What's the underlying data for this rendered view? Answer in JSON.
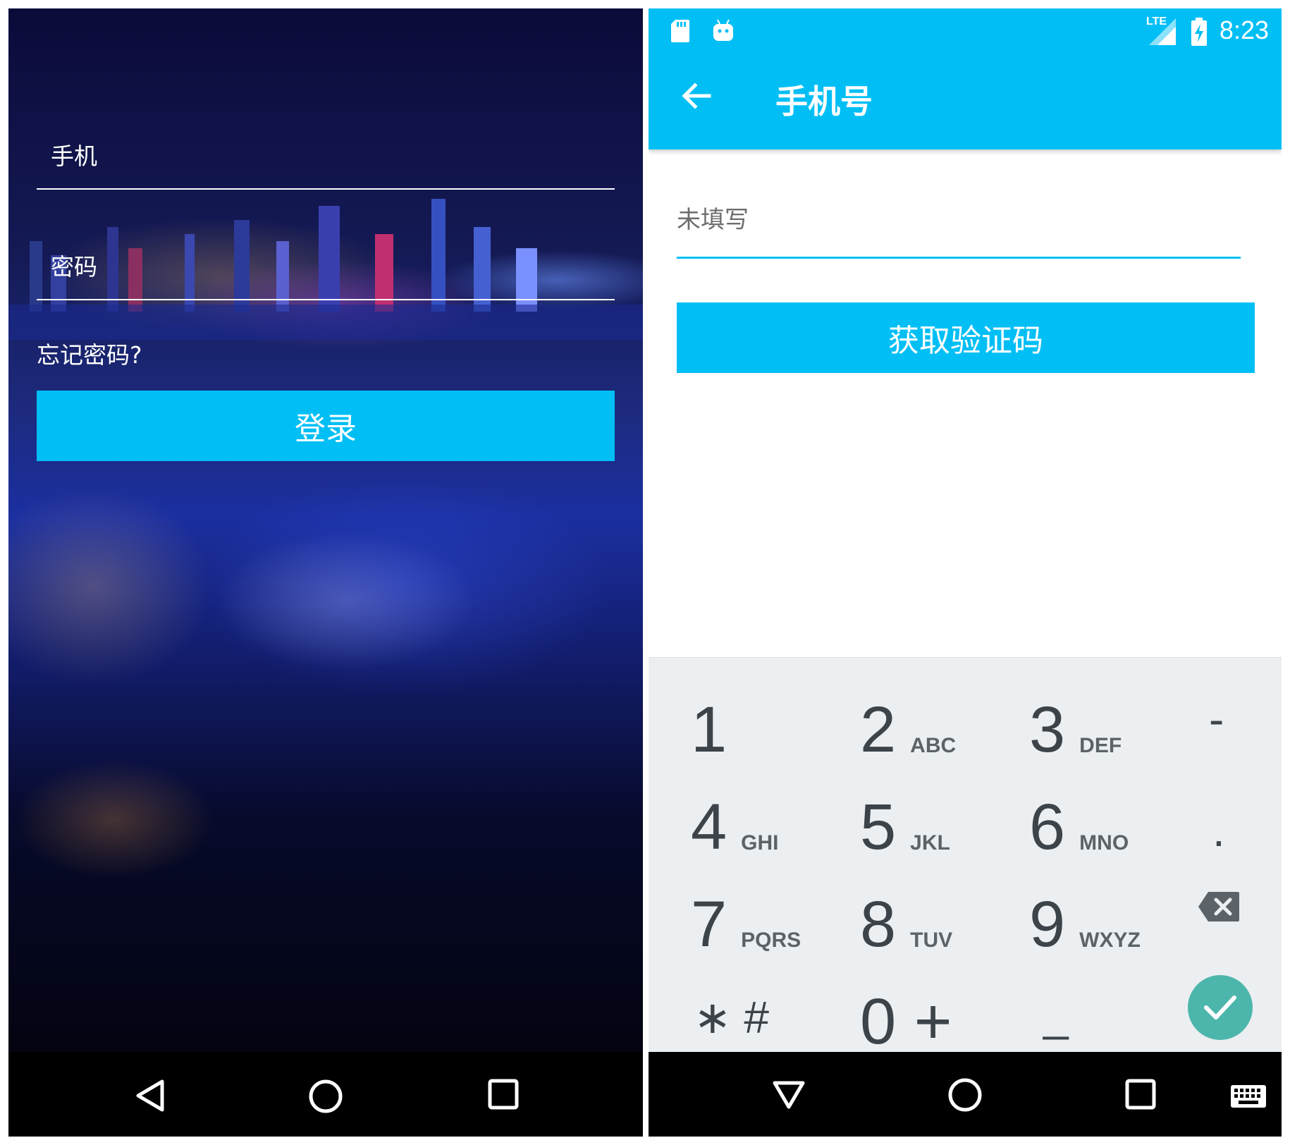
{
  "login_screen": {
    "phone_hint": "手机",
    "password_hint": "密码",
    "forgot_password": "忘记密码?",
    "login_button": "登录",
    "nav": [
      "back-icon",
      "home-icon",
      "recents-icon"
    ]
  },
  "phone_screen": {
    "status_bar": {
      "time": "8:23",
      "network": "LTE",
      "icons": [
        "sd-card-icon",
        "android-icon",
        "signal-icon",
        "battery-charging-icon"
      ]
    },
    "app_bar": {
      "title": "手机号",
      "back_icon": "arrow-left-icon"
    },
    "phone_field": {
      "placeholder": "未填写",
      "value": ""
    },
    "get_code_button": "获取验证码",
    "keypad": {
      "rows": [
        [
          {
            "digit": "1",
            "letters": ""
          },
          {
            "digit": "2",
            "letters": "ABC"
          },
          {
            "digit": "3",
            "letters": "DEF"
          },
          {
            "symbol": "-"
          }
        ],
        [
          {
            "digit": "4",
            "letters": "GHI"
          },
          {
            "digit": "5",
            "letters": "JKL"
          },
          {
            "digit": "6",
            "letters": "MNO"
          },
          {
            "symbol": "."
          }
        ],
        [
          {
            "digit": "7",
            "letters": "PQRS"
          },
          {
            "digit": "8",
            "letters": "TUV"
          },
          {
            "digit": "9",
            "letters": "WXYZ"
          },
          {
            "icon": "backspace-icon"
          }
        ],
        [
          {
            "symbol": "∗ #"
          },
          {
            "symbol": "0 +"
          },
          {
            "symbol": "_"
          },
          {
            "icon": "check-icon"
          }
        ]
      ]
    },
    "nav": [
      "back-down-icon",
      "home-icon",
      "recents-icon",
      "keyboard-icon"
    ],
    "colors": {
      "accent": "#01bff5",
      "done": "#4db6ac",
      "keypad_bg": "#eceff1"
    }
  }
}
